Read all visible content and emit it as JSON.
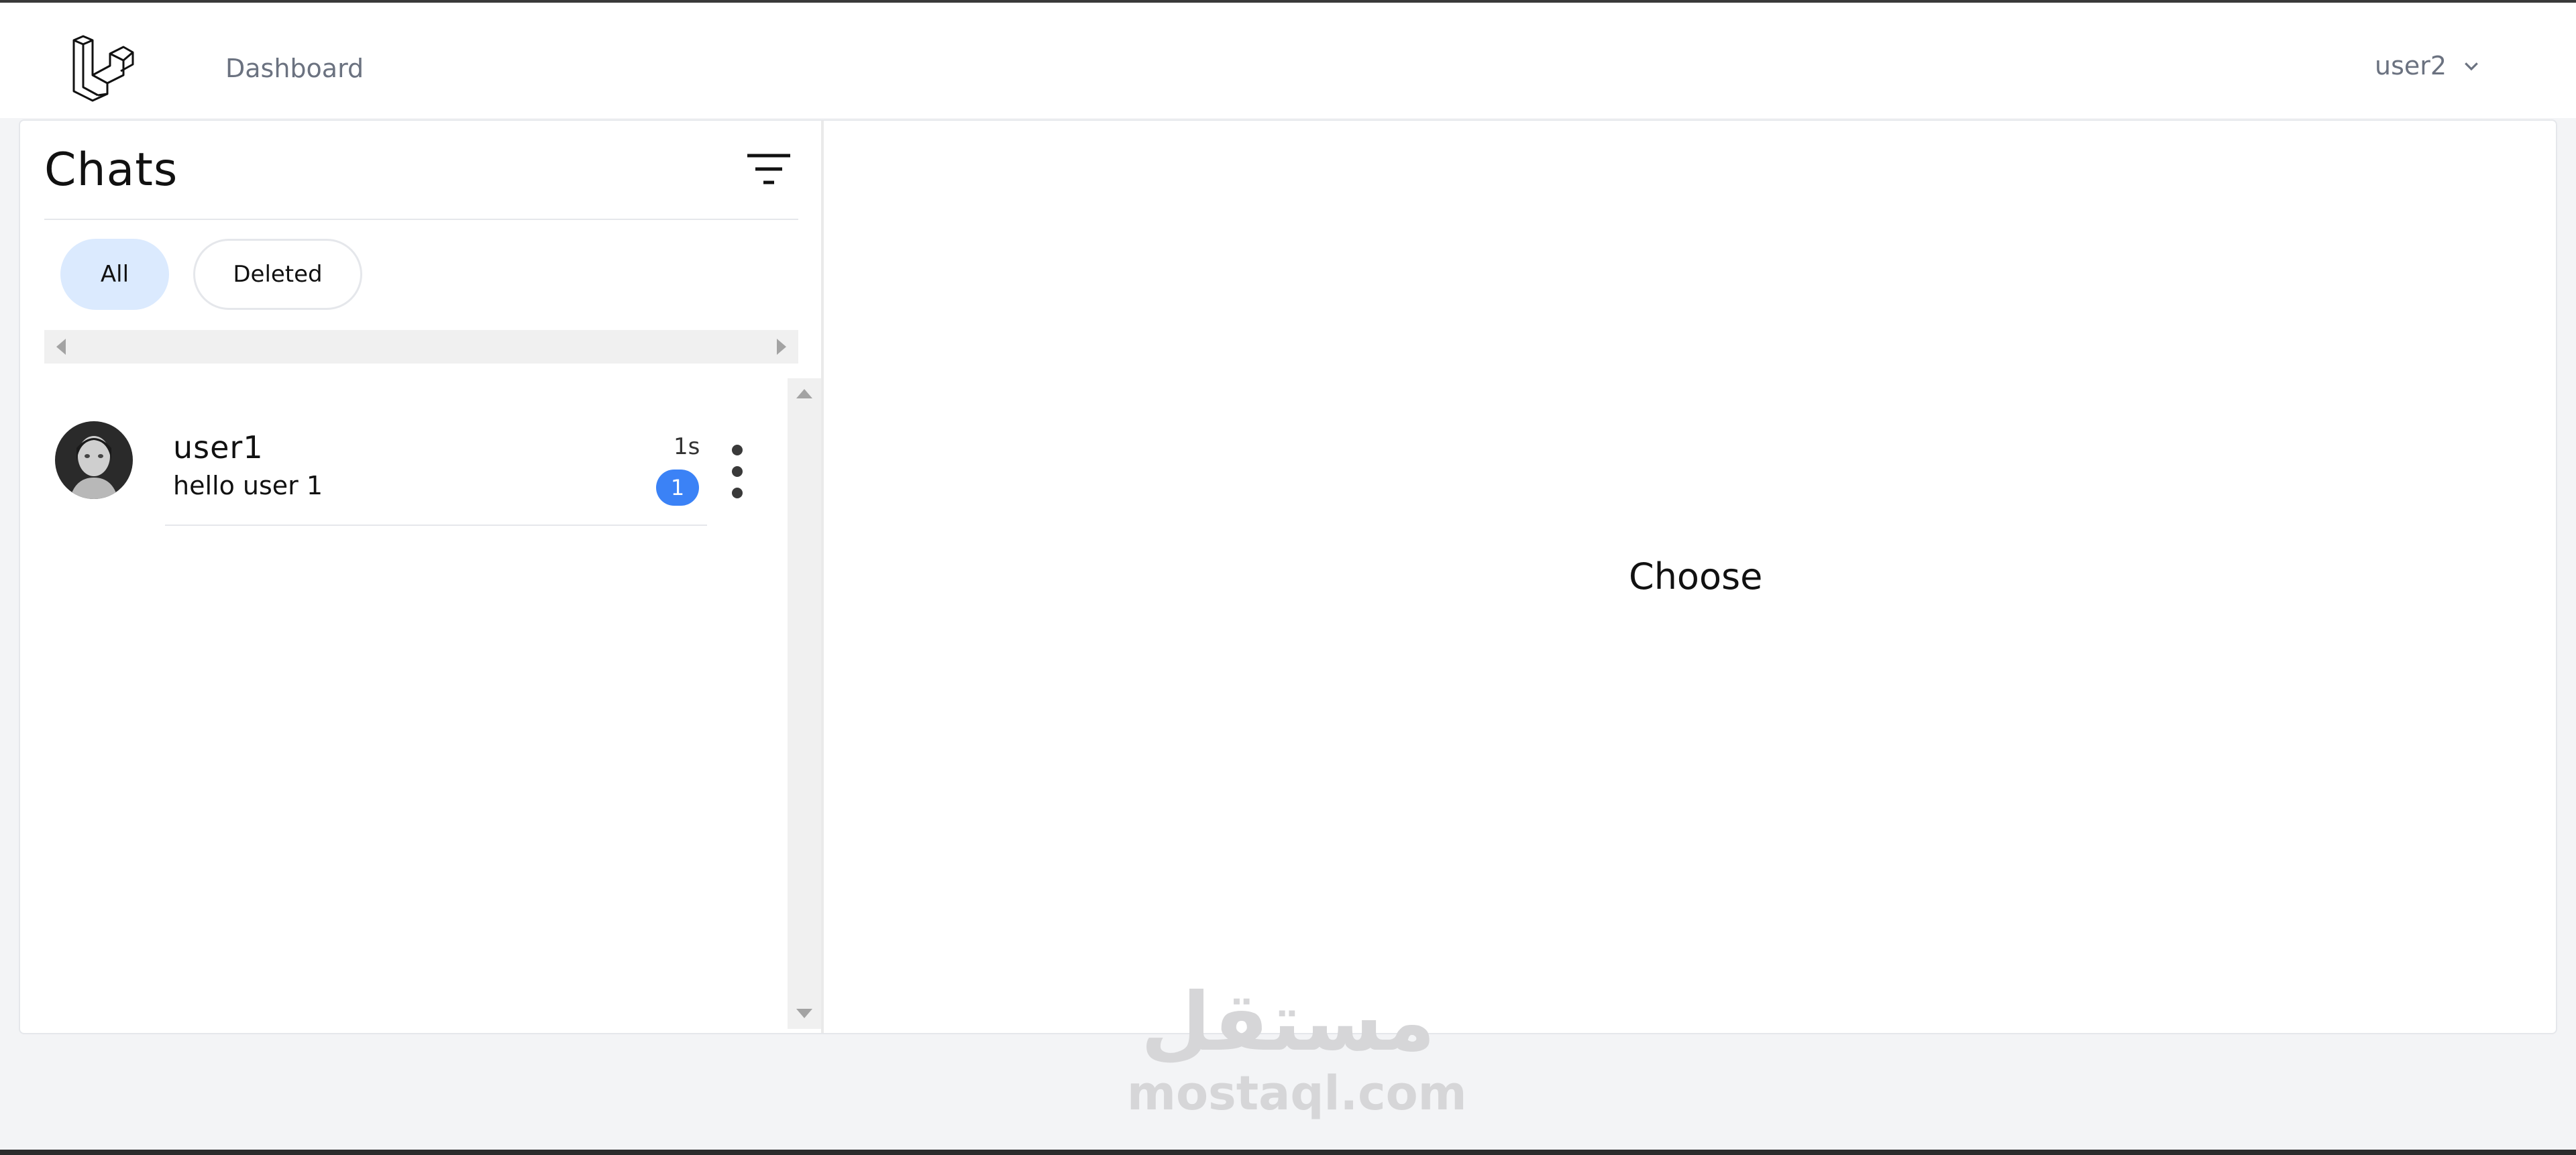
{
  "nav": {
    "link": "Dashboard",
    "user": "user2"
  },
  "chats": {
    "title": "Chats",
    "filters": [
      "All",
      "Deleted"
    ],
    "items": [
      {
        "name": "user1",
        "message": "hello user 1",
        "time": "1s",
        "unread": "1"
      }
    ]
  },
  "main": {
    "placeholder": "Choose"
  },
  "watermark": {
    "arabic": "مستقل",
    "latin": "mostaql.com"
  },
  "colors": {
    "accent": "#3b82f6",
    "pill_active": "#dbeafe",
    "background": "#f3f4f6"
  },
  "icons": [
    "laravel-logo-icon",
    "chevron-down-icon",
    "filter-icon",
    "more-vertical-icon"
  ]
}
